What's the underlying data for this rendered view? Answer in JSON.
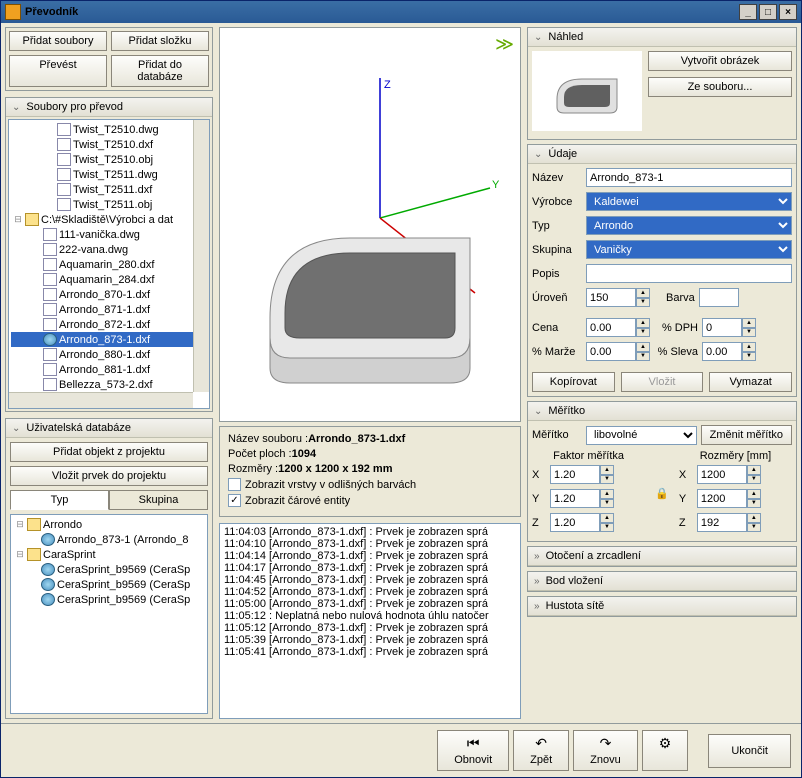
{
  "window": {
    "title": "Převodník"
  },
  "left": {
    "btn_add_files": "Přidat soubory",
    "btn_add_folder": "Přidat složku",
    "btn_convert": "Převést",
    "btn_add_db": "Přidat do databáze",
    "panel_files": "Soubory pro převod",
    "tree_root2": "C:\\#Skladiště\\Výrobci a dat",
    "files1": [
      "Twist_T2510.dwg",
      "Twist_T2510.dxf",
      "Twist_T2510.obj",
      "Twist_T2511.dwg",
      "Twist_T2511.dxf",
      "Twist_T2511.obj"
    ],
    "files2": [
      "111-vanička.dwg",
      "222-vana.dwg",
      "Aquamarin_280.dxf",
      "Aquamarin_284.dxf",
      "Arrondo_870-1.dxf",
      "Arrondo_871-1.dxf",
      "Arrondo_872-1.dxf",
      "Arrondo_873-1.dxf",
      "Arrondo_880-1.dxf",
      "Arrondo_881-1.dxf",
      "Bellezza_573-2.dxf"
    ],
    "selected_file": "Arrondo_873-1.dxf",
    "panel_db": "Uživatelská databáze",
    "btn_add_obj": "Přidat objekt z projektu",
    "btn_insert": "Vložit prvek do projektu",
    "tab_type": "Typ",
    "tab_group": "Skupina",
    "db_tree": {
      "n1": "Arrondo",
      "n1_c1": "Arrondo_873-1 (Arrondo_8",
      "n2": "CaraSprint",
      "n2_c1": "CeraSprint_b9569 (CeraSp",
      "n2_c2": "CeraSprint_b9569 (CeraSp",
      "n2_c3": "CeraSprint_b9569 (CeraSp"
    }
  },
  "center": {
    "info_name_label": "Název souboru :",
    "info_name": "Arrondo_873-1.dxf",
    "info_faces_label": "Počet ploch :",
    "info_faces": "1094",
    "info_dims_label": "Rozměry :",
    "info_dims": "1200 x 1200 x 192 mm",
    "chk_layers": "Zobrazit vrstvy v odlišných barvách",
    "chk_lines": "Zobrazit čárové entity",
    "log": [
      "11:04:03 [Arrondo_873-1.dxf] : Prvek je zobrazen sprá",
      "11:04:10 [Arrondo_873-1.dxf] : Prvek je zobrazen sprá",
      "11:04:14 [Arrondo_873-1.dxf] : Prvek je zobrazen sprá",
      "11:04:17 [Arrondo_873-1.dxf] : Prvek je zobrazen sprá",
      "11:04:45 [Arrondo_873-1.dxf] : Prvek je zobrazen sprá",
      "11:04:52 [Arrondo_873-1.dxf] : Prvek je zobrazen sprá",
      "11:05:00 [Arrondo_873-1.dxf] : Prvek je zobrazen sprá",
      "11:05:12 : Neplatná nebo nulová hodnota úhlu natočer",
      "11:05:12 [Arrondo_873-1.dxf] : Prvek je zobrazen sprá",
      "11:05:39 [Arrondo_873-1.dxf] : Prvek je zobrazen sprá",
      "11:05:41 [Arrondo_873-1.dxf] : Prvek je zobrazen sprá"
    ]
  },
  "right": {
    "panel_preview": "Náhled",
    "btn_create_img": "Vytvořit obrázek",
    "btn_from_file": "Ze souboru...",
    "panel_data": "Údaje",
    "lbl_name": "Název",
    "val_name": "Arrondo_873-1",
    "lbl_mfr": "Výrobce",
    "val_mfr": "Kaldewei",
    "lbl_type": "Typ",
    "val_type": "Arrondo",
    "lbl_group": "Skupina",
    "val_group": "Vaničky",
    "lbl_desc": "Popis",
    "val_desc": "",
    "lbl_level": "Úroveň",
    "val_level": "150",
    "lbl_color": "Barva",
    "lbl_price": "Cena",
    "val_price": "0.00",
    "lbl_vat": "% DPH",
    "val_vat": "0",
    "lbl_margin": "% Marže",
    "val_margin": "0.00",
    "lbl_discount": "% Sleva",
    "val_discount": "0.00",
    "btn_copy": "Kopírovat",
    "btn_paste": "Vložit",
    "btn_delete": "Vymazat",
    "panel_scale": "Měřítko",
    "lbl_scale": "Měřítko",
    "val_scale": "libovolné",
    "btn_change_scale": "Změnit měřítko",
    "lbl_factor": "Faktor měřítka",
    "lbl_dims": "Rozměry [mm]",
    "fx": "1.20",
    "fy": "1.20",
    "fz": "1.20",
    "dx": "1200",
    "dy": "1200",
    "dz": "192",
    "panel_rot": "Otočení a zrcadlení",
    "panel_ins": "Bod vložení",
    "panel_mesh": "Hustota sítě"
  },
  "bottom": {
    "refresh": "Obnovit",
    "undo": "Zpět",
    "redo": "Znovu",
    "close": "Ukončit"
  }
}
